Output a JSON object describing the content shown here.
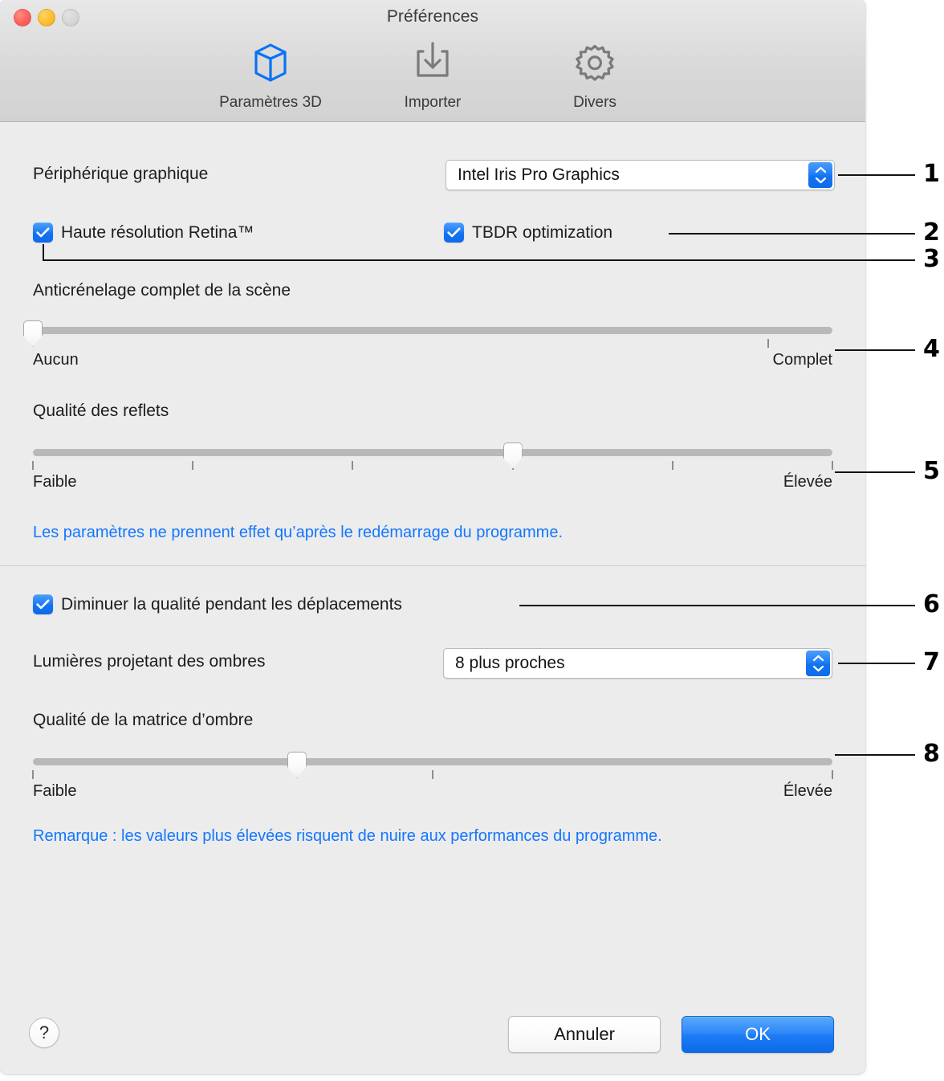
{
  "window": {
    "title": "Préférences",
    "traffic_lights": [
      "close-button",
      "minimize-button",
      "zoom-button"
    ]
  },
  "toolbar": {
    "items": [
      {
        "label": "Paramètres 3D",
        "icon": "cube-3d-icon",
        "selected": true
      },
      {
        "label": "Importer",
        "icon": "import-download-icon",
        "selected": false
      },
      {
        "label": "Divers",
        "icon": "gear-icon",
        "selected": false
      }
    ]
  },
  "section_3d": {
    "graphics_device": {
      "label": "Périphérique graphique",
      "value": "Intel Iris Pro Graphics"
    },
    "retina_checkbox": {
      "label": "Haute résolution Retina™",
      "checked": true
    },
    "tbdr_checkbox": {
      "label": "TBDR optimization",
      "checked": true
    },
    "antialiasing_slider": {
      "label": "Anticrénelage complet de la scène",
      "min_label": "Aucun",
      "max_label": "Complet",
      "value_percent": 0,
      "tick_percents": [
        92
      ]
    },
    "reflection_slider": {
      "label": "Qualité des reflets",
      "min_label": "Faible",
      "max_label": "Élevée",
      "value_percent": 60,
      "tick_percents": [
        0,
        20,
        40,
        60,
        80,
        100
      ]
    },
    "restart_note": "Les paramètres ne prennent effet qu’après le redémarrage du programme."
  },
  "section_shadows": {
    "reduce_quality_checkbox": {
      "label": "Diminuer la qualité pendant les déplacements",
      "checked": true
    },
    "shadow_lights": {
      "label": "Lumières projetant des ombres",
      "value": "8 plus proches"
    },
    "shadow_matrix_slider": {
      "label": "Qualité de la matrice d’ombre",
      "min_label": "Faible",
      "max_label": "Élevée",
      "value_percent": 33,
      "tick_percents": [
        0,
        50,
        100
      ]
    },
    "performance_note": "Remarque : les valeurs plus élevées risquent de nuire aux performances du programme."
  },
  "footer": {
    "help_label": "?",
    "cancel_label": "Annuler",
    "ok_label": "OK"
  },
  "callouts": [
    {
      "number": "1"
    },
    {
      "number": "2"
    },
    {
      "number": "3"
    },
    {
      "number": "4"
    },
    {
      "number": "5"
    },
    {
      "number": "6"
    },
    {
      "number": "7"
    },
    {
      "number": "8"
    }
  ],
  "colors": {
    "accent_blue": "#1d7cf5",
    "note_blue": "#1477ff",
    "window_bg": "#ececec",
    "titlebar_bg": "#d9d9d9",
    "track_gray": "#b9b9b9"
  }
}
